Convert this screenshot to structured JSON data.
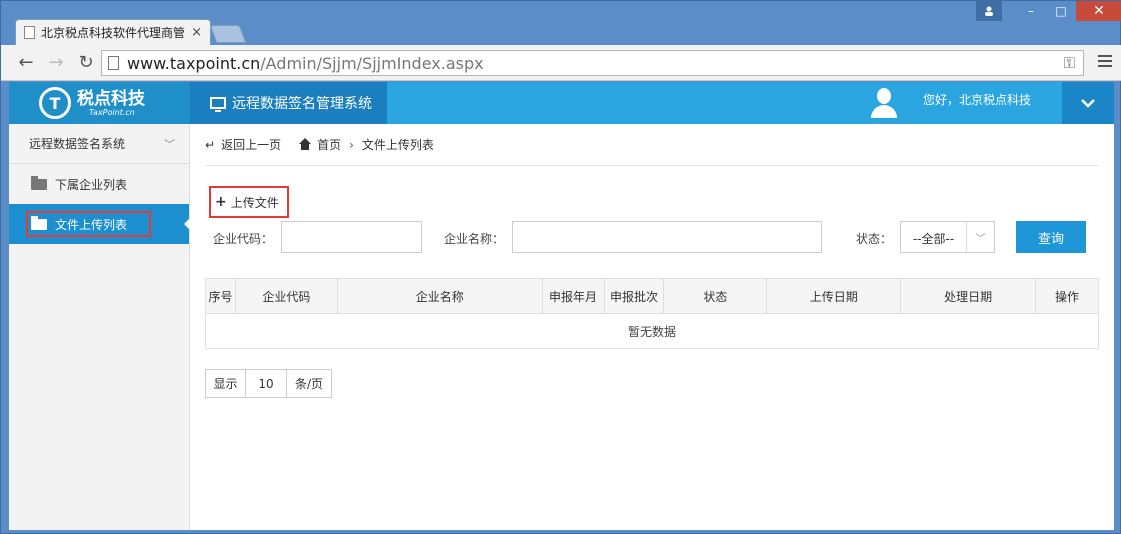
{
  "browser": {
    "tab_title": "北京税点科技软件代理商管",
    "tab_close": "×",
    "url_host": "www.taxpoint.cn",
    "url_path": "/Admin/Sjjm/SjjmIndex.aspx",
    "controls": {
      "minimize": "–",
      "maximize": "□",
      "close": "✕"
    }
  },
  "header": {
    "logo_cn": "税点科技",
    "logo_en": "TaxPoint.cn",
    "logo_mark": "T",
    "system_name": "远程数据签名管理系统",
    "greeting": "您好，北京税点科技"
  },
  "sidebar": {
    "title": "远程数据签名系统",
    "items": [
      {
        "label": "下属企业列表"
      },
      {
        "label": "文件上传列表"
      }
    ]
  },
  "breadcrumb": {
    "back": "返回上一页",
    "home": "首页",
    "current": "文件上传列表"
  },
  "actions": {
    "upload": "上传文件"
  },
  "filters": {
    "code_label": "企业代码：",
    "name_label": "企业名称：",
    "status_label": "状态：",
    "status_value": "--全部--",
    "query": "查询"
  },
  "table": {
    "headers": [
      "序号",
      "企业代码",
      "企业名称",
      "申报年月",
      "申报批次",
      "状态",
      "上传日期",
      "处理日期",
      "操作"
    ],
    "empty": "暂无数据"
  },
  "pager": {
    "show": "显示",
    "size": "10",
    "unit": "条/页"
  },
  "colors": {
    "topbar": "#2aa5e0",
    "accent": "#1e96d8",
    "highlight": "#e53935"
  }
}
